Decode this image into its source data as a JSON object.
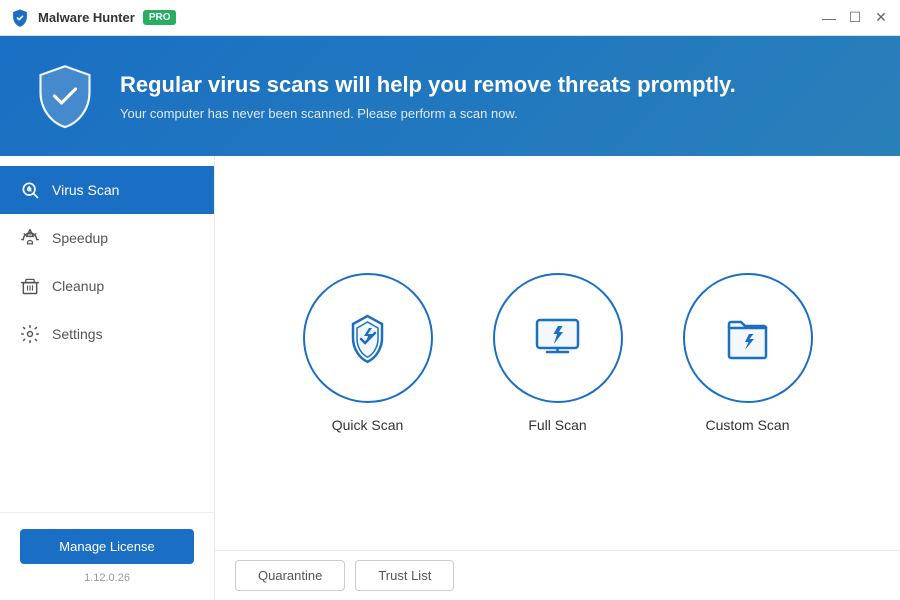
{
  "titlebar": {
    "app_name": "Malware Hunter",
    "pro_label": "PRO",
    "minimize": "—",
    "maximize": "☐",
    "close": "✕"
  },
  "header": {
    "headline": "Regular virus scans will help you remove threats promptly.",
    "subtext": "Your computer has never been scanned. Please perform a scan now."
  },
  "sidebar": {
    "items": [
      {
        "label": "Virus Scan",
        "icon": "virus-scan-icon"
      },
      {
        "label": "Speedup",
        "icon": "speedup-icon"
      },
      {
        "label": "Cleanup",
        "icon": "cleanup-icon"
      },
      {
        "label": "Settings",
        "icon": "settings-icon"
      }
    ],
    "manage_license": "Manage License",
    "version": "1.12.0.26"
  },
  "scan_options": [
    {
      "label": "Quick Scan",
      "icon": "quick-scan-icon"
    },
    {
      "label": "Full Scan",
      "icon": "full-scan-icon"
    },
    {
      "label": "Custom Scan",
      "icon": "custom-scan-icon"
    }
  ],
  "footer_buttons": [
    {
      "label": "Quarantine"
    },
    {
      "label": "Trust List"
    }
  ]
}
